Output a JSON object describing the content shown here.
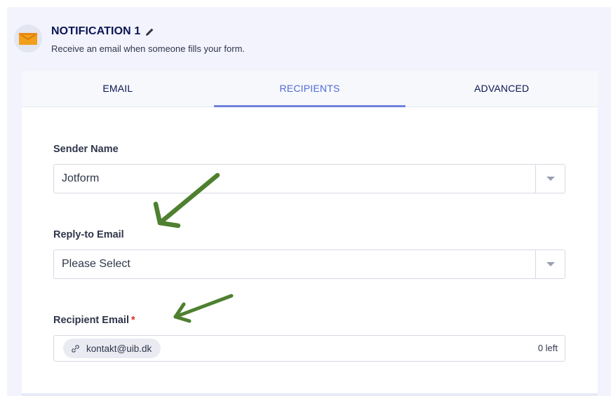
{
  "notification": {
    "title": "NOTIFICATION 1",
    "subtitle": "Receive an email when someone fills your form.",
    "icon": "envelope-icon",
    "edit_icon": "pencil-icon"
  },
  "tabs": [
    {
      "label": "EMAIL",
      "active": false
    },
    {
      "label": "RECIPIENTS",
      "active": true
    },
    {
      "label": "ADVANCED",
      "active": false
    }
  ],
  "fields": {
    "sender_name": {
      "label": "Sender Name",
      "value": "Jotform"
    },
    "reply_to": {
      "label": "Reply-to Email",
      "value": "Please Select"
    },
    "recipient": {
      "label": "Recipient Email",
      "required_mark": "*",
      "tags": [
        "kontakt@uib.dk"
      ],
      "remaining": "0 left"
    }
  },
  "colors": {
    "accent": "#4d6ad6",
    "title": "#0a1551",
    "annotation_arrow": "#4e8030",
    "required": "#d32f2f"
  }
}
